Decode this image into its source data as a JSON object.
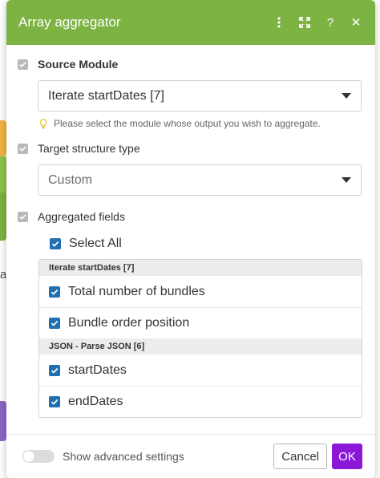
{
  "dialog": {
    "title": "Array aggregator",
    "header_color": "#7cb342",
    "header_actions": [
      "more-vertical-icon",
      "expand-icon",
      "help-icon",
      "close-icon"
    ],
    "help_glyph": "?",
    "close_glyph": "✕"
  },
  "source_module": {
    "label": "Source Module",
    "selected": "Iterate startDates [7]",
    "hint": "Please select the module whose output you wish to aggregate."
  },
  "target_structure": {
    "label": "Target structure type",
    "selected": "Custom"
  },
  "aggregated_fields": {
    "label": "Aggregated fields",
    "select_all_label": "Select All",
    "select_all_checked": true,
    "groups": [
      {
        "header": "Iterate startDates [7]",
        "fields": [
          {
            "label": "Total number of bundles",
            "checked": true
          },
          {
            "label": "Bundle order position",
            "checked": true
          }
        ]
      },
      {
        "header": "JSON - Parse JSON [6]",
        "fields": [
          {
            "label": "startDates",
            "checked": true
          },
          {
            "label": "endDates",
            "checked": true
          }
        ]
      }
    ]
  },
  "footer": {
    "advanced_toggle_label": "Show advanced settings",
    "advanced_enabled": false,
    "cancel_label": "Cancel",
    "ok_label": "OK",
    "ok_color": "#8b17d9"
  },
  "background": {
    "partial_letter": "a"
  }
}
